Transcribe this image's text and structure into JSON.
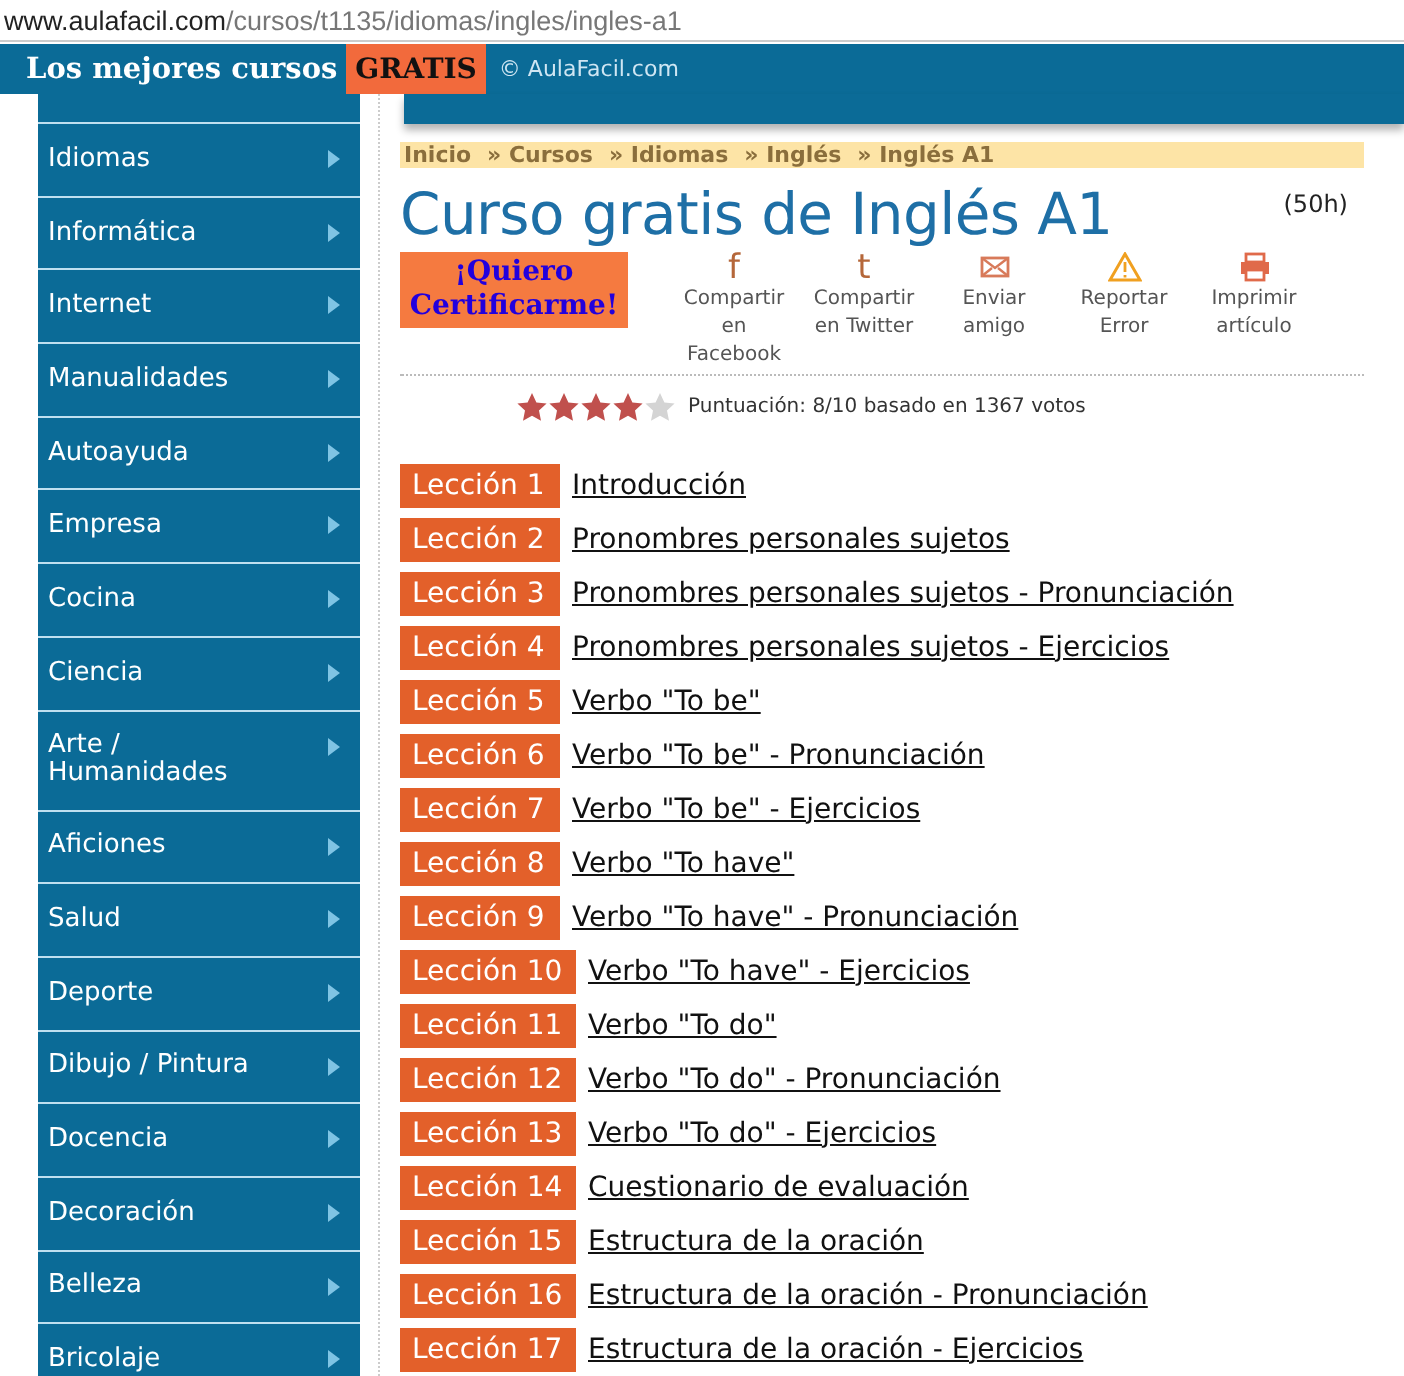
{
  "address_bar": {
    "domain": "www.aulafacil.com",
    "path": "/cursos/t1135/idiomas/ingles/ingles-a1"
  },
  "header": {
    "slogan": "Los mejores cursos",
    "highlight": "GRATIS",
    "copyright": "© AulaFacil.com"
  },
  "sidebar": {
    "items": [
      {
        "label": "Idiomas"
      },
      {
        "label": "Informática"
      },
      {
        "label": "Internet"
      },
      {
        "label": "Manualidades"
      },
      {
        "label": "Autoayuda"
      },
      {
        "label": "Empresa"
      },
      {
        "label": "Cocina"
      },
      {
        "label": "Ciencia"
      },
      {
        "label": "Arte / Humanidades"
      },
      {
        "label": "Aficiones"
      },
      {
        "label": "Salud"
      },
      {
        "label": "Deporte"
      },
      {
        "label": "Dibujo / Pintura"
      },
      {
        "label": "Docencia"
      },
      {
        "label": "Decoración"
      },
      {
        "label": "Belleza"
      },
      {
        "label": "Bricolaje"
      }
    ]
  },
  "breadcrumb": [
    "Inicio",
    "» Cursos",
    "» Idiomas",
    "» Inglés",
    "» Inglés A1"
  ],
  "title": "Curso gratis de Inglés A1",
  "duration": "(50h)",
  "certify_button": "¡Quiero Certificarme!",
  "share_actions": [
    {
      "kind": "facebook",
      "glyph": "f",
      "label": "Compartir en Facebook"
    },
    {
      "kind": "twitter",
      "glyph": "t",
      "label": "Compartir en Twitter"
    },
    {
      "kind": "mail",
      "label": "Enviar amigo"
    },
    {
      "kind": "warning",
      "label": "Reportar Error"
    },
    {
      "kind": "print",
      "label": "Imprimir artículo"
    }
  ],
  "rating": {
    "stars": 4,
    "text": "Puntuación: 8/10 basado en 1367 votos"
  },
  "lessons": [
    {
      "number": "Lección 1",
      "title": "Introducción"
    },
    {
      "number": "Lección 2",
      "title": "Pronombres personales sujetos"
    },
    {
      "number": "Lección 3",
      "title": "Pronombres personales sujetos - Pronunciación"
    },
    {
      "number": "Lección 4",
      "title": "Pronombres personales sujetos - Ejercicios"
    },
    {
      "number": "Lección 5",
      "title": "Verbo \"To be\""
    },
    {
      "number": "Lección 6",
      "title": "Verbo \"To be\" - Pronunciación"
    },
    {
      "number": "Lección 7",
      "title": "Verbo \"To be\" - Ejercicios"
    },
    {
      "number": "Lección 8",
      "title": "Verbo \"To have\""
    },
    {
      "number": "Lección 9",
      "title": "Verbo \"To have\" - Pronunciación"
    },
    {
      "number": "Lección 10",
      "title": "Verbo \"To have\" - Ejercicios"
    },
    {
      "number": "Lección 11",
      "title": "Verbo \"To do\""
    },
    {
      "number": "Lección 12",
      "title": "Verbo \"To do\" - Pronunciación"
    },
    {
      "number": "Lección 13",
      "title": "Verbo \"To do\" - Ejercicios"
    },
    {
      "number": "Lección 14",
      "title": "Cuestionario de evaluación"
    },
    {
      "number": "Lección 15",
      "title": "Estructura de la oración"
    },
    {
      "number": "Lección 16",
      "title": "Estructura de la oración - Pronunciación"
    },
    {
      "number": "Lección 17",
      "title": "Estructura de la oración - Ejercicios"
    }
  ]
}
